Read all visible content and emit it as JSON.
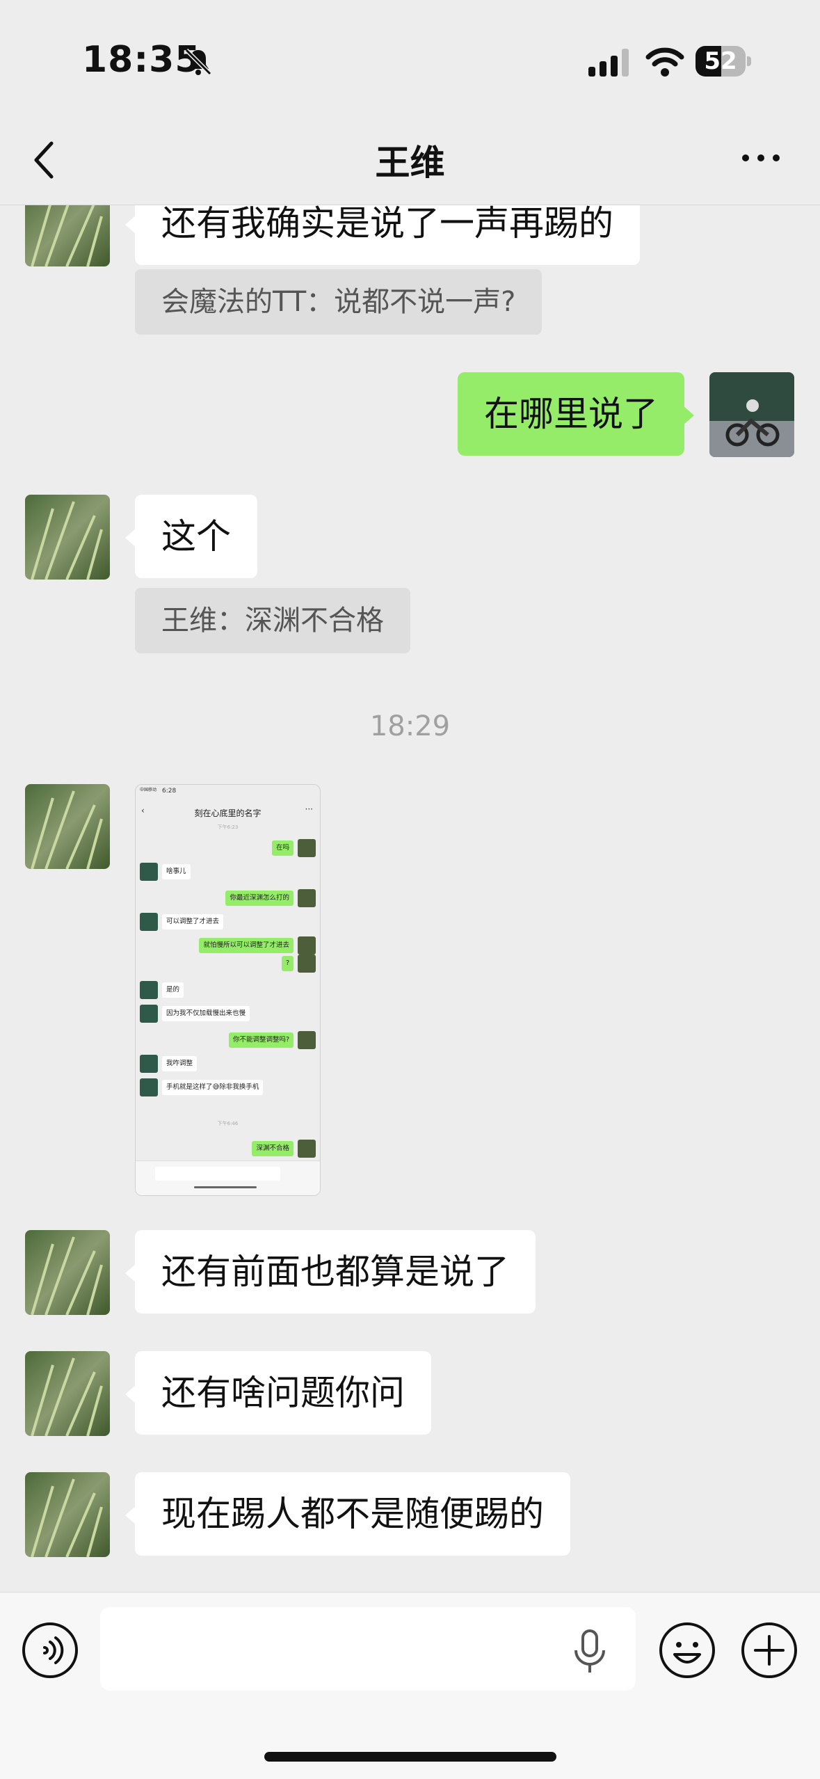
{
  "status_bar": {
    "time": "18:35",
    "battery": "52",
    "battery_level": 0.52,
    "icons": [
      "bell-slash-icon",
      "cellular-signal-icon",
      "wifi-icon",
      "battery-icon"
    ]
  },
  "nav": {
    "title": "王维",
    "icons": [
      "chevron-left-icon",
      "more-horizontal-icon"
    ]
  },
  "messages": [
    {
      "side": "left",
      "type": "text",
      "text": "还有我确实是说了一声再踢的"
    },
    {
      "side": "left",
      "type": "quote",
      "text": "会魔法的TT：说都不说一声?"
    },
    {
      "side": "right",
      "type": "text",
      "text": "在哪里说了"
    },
    {
      "side": "left",
      "type": "text",
      "text": "这个"
    },
    {
      "side": "left",
      "type": "quote",
      "text": "王维：深渊不合格"
    },
    {
      "type": "timestamp",
      "text": "18:29"
    },
    {
      "side": "left",
      "type": "image",
      "text": ""
    },
    {
      "side": "left",
      "type": "text",
      "text": "还有前面也都算是说了"
    },
    {
      "side": "left",
      "type": "text",
      "text": "还有啥问题你问"
    },
    {
      "side": "left",
      "type": "text",
      "text": "现在踢人都不是随便踢的"
    }
  ],
  "screenshot_thumb": {
    "status_time": "6:28",
    "carrier": "中国移动",
    "title": "刻在心底里的名字",
    "top_time": "下午6:23",
    "bottom_time": "下午6:46",
    "items": [
      {
        "side": "right",
        "text": "在吗"
      },
      {
        "side": "left",
        "text": "啥事儿"
      },
      {
        "side": "right",
        "text": "你最近深渊怎么打的"
      },
      {
        "side": "left",
        "text": "可以调整了才进去"
      },
      {
        "side": "right",
        "text": "就怕慢所以可以调整了才进去"
      },
      {
        "side": "right",
        "text": "?"
      },
      {
        "side": "left",
        "text": "是的"
      },
      {
        "side": "left",
        "text": "因为我不仅加载慢出来也慢"
      },
      {
        "side": "right",
        "text": "你不能调整调整吗?"
      },
      {
        "side": "left",
        "text": "我咋调整"
      },
      {
        "side": "left",
        "text": "手机就是这样了😅除非我换手机"
      },
      {
        "side": "right",
        "text": "深渊不合格"
      }
    ]
  },
  "input_bar": {
    "placeholder": "",
    "icons": [
      "voice-icon",
      "microphone-icon",
      "emoji-icon",
      "plus-circle-icon"
    ]
  },
  "colors": {
    "background": "#ededed",
    "sent_bubble": "#95ec69",
    "received_bubble": "#ffffff",
    "quote_bg": "#dedede"
  }
}
